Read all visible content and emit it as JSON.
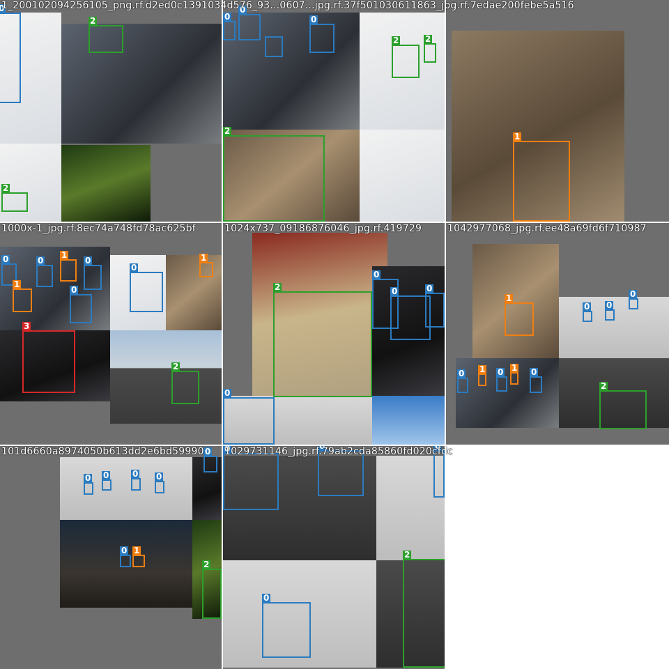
{
  "colors": {
    "class_0": "#2b7bc0",
    "class_1": "#f07f12",
    "class_2": "#2ca02c",
    "class_3": "#d62728"
  },
  "tiles": [
    {
      "title": "1_200102094256105_png.rf.d2ed0c1391034d576_93...0607...jpg.rf.37f501030611863_jpg.rf.7edae200febe5a516",
      "labels": [
        "0",
        "2",
        "0",
        "0",
        "0",
        "2",
        "2",
        "0",
        "2",
        "2",
        "1"
      ]
    },
    {
      "title": "1000x-1_jpg.rf.8ec74a748fd78ac625bf",
      "labels": [
        "0",
        "0",
        "0",
        "1",
        "0",
        "1",
        "0",
        "0",
        "1",
        "3",
        "2"
      ]
    },
    {
      "title": "1024x737_09186876046_jpg.rf.419729",
      "labels": [
        "2",
        "0",
        "0",
        "0",
        "0",
        "0",
        "0",
        "0"
      ]
    },
    {
      "title": "1042977068_jpg.rf.ee48a69fd6f710987",
      "labels": [
        "0",
        "1",
        "0",
        "0",
        "0",
        "0",
        "1",
        "0",
        "1",
        "0",
        "2"
      ]
    },
    {
      "title": "101d6660a8974050b613dd2e6bd59990",
      "labels": [
        "0",
        "0",
        "0",
        "0",
        "0",
        "0",
        "1",
        "0",
        "2"
      ]
    },
    {
      "title": "1029731146_jpg.rf.79ab2cda85860fd020cfdc",
      "labels": [
        "0",
        "0",
        "0",
        "0",
        "0",
        "2"
      ]
    }
  ]
}
